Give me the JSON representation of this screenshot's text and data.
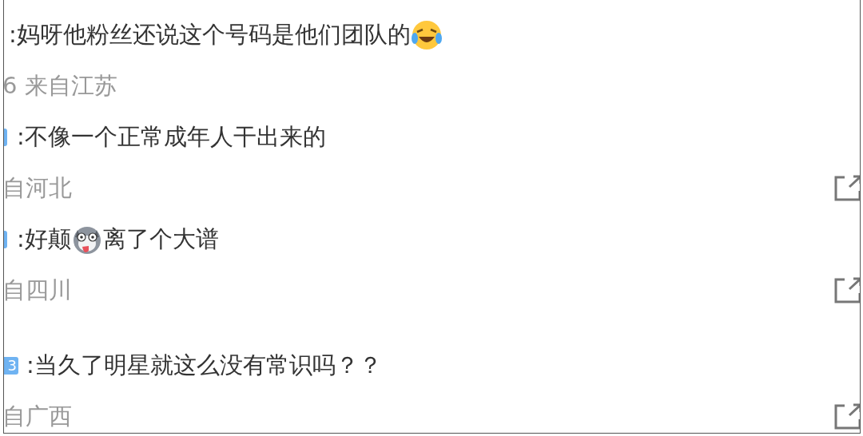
{
  "comments": [
    {
      "has_badge": false,
      "segments": [
        {
          "kind": "text",
          "text": ":妈呀他粉丝还说这个号码是他们团队的"
        },
        {
          "kind": "laugh"
        }
      ],
      "meta": "6 来自江苏",
      "share": false
    },
    {
      "has_badge": true,
      "segments": [
        {
          "kind": "text",
          "text": ":不像一个正常成年人干出来的"
        }
      ],
      "meta": "自河北",
      "share": true
    },
    {
      "has_badge": true,
      "segments": [
        {
          "kind": "text",
          "text": ":好颠"
        },
        {
          "kind": "dog"
        },
        {
          "kind": "text",
          "text": "离了个大谱"
        }
      ],
      "meta": "自四川",
      "share": true
    },
    {
      "has_badge": true,
      "badge_text": "3",
      "segments": [
        {
          "kind": "text",
          "text": ":当久了明星就这么没有常识吗？？"
        }
      ],
      "meta": "自广西",
      "share": true
    }
  ]
}
